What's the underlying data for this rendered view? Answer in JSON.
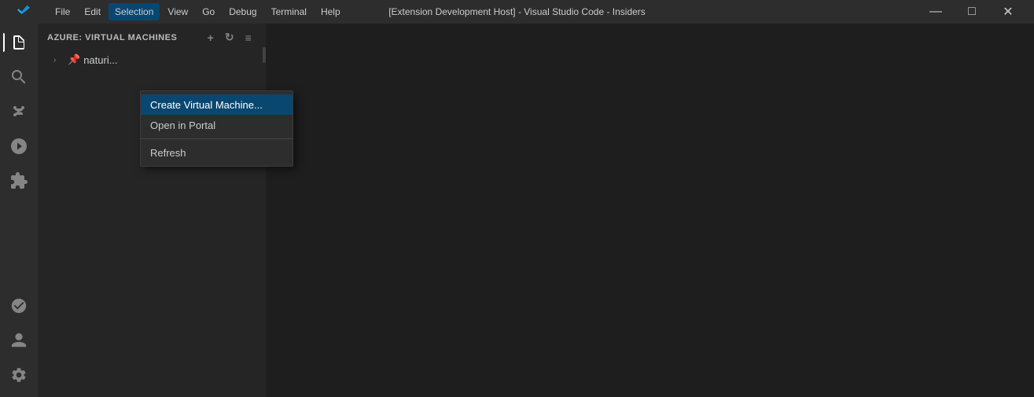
{
  "titleBar": {
    "logo": "VS Code Insiders",
    "menuItems": [
      {
        "label": "File",
        "key": "file"
      },
      {
        "label": "Edit",
        "key": "edit"
      },
      {
        "label": "Selection",
        "key": "selection",
        "active": true
      },
      {
        "label": "View",
        "key": "view"
      },
      {
        "label": "Go",
        "key": "go"
      },
      {
        "label": "Debug",
        "key": "debug"
      },
      {
        "label": "Terminal",
        "key": "terminal"
      },
      {
        "label": "Help",
        "key": "help"
      }
    ],
    "title": "[Extension Development Host] - Visual Studio Code - Insiders",
    "windowButtons": {
      "minimize": "—",
      "maximize": "□",
      "close": "✕"
    }
  },
  "activityBar": {
    "icons": [
      {
        "name": "explorer-icon",
        "symbol": "⎘",
        "active": true
      },
      {
        "name": "search-icon",
        "symbol": "🔍"
      },
      {
        "name": "source-control-icon",
        "symbol": "⎇"
      },
      {
        "name": "run-icon",
        "symbol": "▷"
      },
      {
        "name": "extensions-icon",
        "symbol": "⊞"
      }
    ],
    "bottomIcons": [
      {
        "name": "remote-icon",
        "symbol": "⊙"
      },
      {
        "name": "accounts-icon",
        "symbol": "◉"
      },
      {
        "name": "settings-icon",
        "symbol": "⚙"
      }
    ]
  },
  "sidebar": {
    "title": "Azure: Virtual Machines",
    "headerButtons": [
      {
        "name": "add-btn",
        "symbol": "+"
      },
      {
        "name": "refresh-btn",
        "symbol": "↻"
      },
      {
        "name": "collapse-btn",
        "symbol": "≡"
      }
    ],
    "treeItems": [
      {
        "label": "naturi...",
        "icon": "📌",
        "hasChevron": true
      }
    ]
  },
  "contextMenu": {
    "items": [
      {
        "label": "Create Virtual Machine...",
        "highlighted": true,
        "key": "create-vm"
      },
      {
        "label": "Open in Portal",
        "key": "open-portal"
      },
      {
        "separator": true
      },
      {
        "label": "Refresh",
        "key": "refresh"
      }
    ]
  },
  "editor": {
    "background": "#1e1e1e"
  }
}
